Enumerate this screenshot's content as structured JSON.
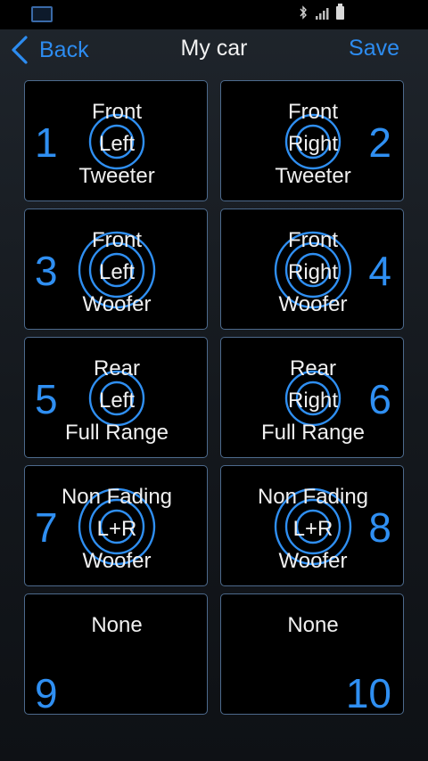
{
  "status_bar": {
    "app_icon": "gallery-thumbnail-icon",
    "icons": [
      "bluetooth-icon",
      "signal-icon",
      "battery-icon"
    ]
  },
  "header": {
    "back_label": "Back",
    "title": "My car",
    "save_label": "Save"
  },
  "colors": {
    "accent": "#2d8cf0",
    "ring": "#2f8ff2",
    "tile_border": "#4d6a8c",
    "tile_bg": "#000000"
  },
  "speakers": [
    {
      "number": "1",
      "lines": [
        "Front",
        "Left",
        "Tweeter"
      ],
      "side": "left",
      "rings": 2
    },
    {
      "number": "2",
      "lines": [
        "Front",
        "Right",
        "Tweeter"
      ],
      "side": "right",
      "rings": 2
    },
    {
      "number": "3",
      "lines": [
        "Front",
        "Left",
        "Woofer"
      ],
      "side": "left",
      "rings": 3
    },
    {
      "number": "4",
      "lines": [
        "Front",
        "Right",
        "Woofer"
      ],
      "side": "right",
      "rings": 3
    },
    {
      "number": "5",
      "lines": [
        "Rear",
        "Left",
        "Full Range"
      ],
      "side": "left",
      "rings": 2
    },
    {
      "number": "6",
      "lines": [
        "Rear",
        "Right",
        "Full Range"
      ],
      "side": "right",
      "rings": 2
    },
    {
      "number": "7",
      "lines": [
        "Non Fading",
        "L+R",
        "Woofer"
      ],
      "side": "left",
      "rings": 3
    },
    {
      "number": "8",
      "lines": [
        "Non Fading",
        "L+R",
        "Woofer"
      ],
      "side": "right",
      "rings": 3
    },
    {
      "number": "9",
      "lines": [
        "None"
      ],
      "side": "left",
      "rings": 0
    },
    {
      "number": "10",
      "lines": [
        "None"
      ],
      "side": "right",
      "rings": 0
    }
  ]
}
